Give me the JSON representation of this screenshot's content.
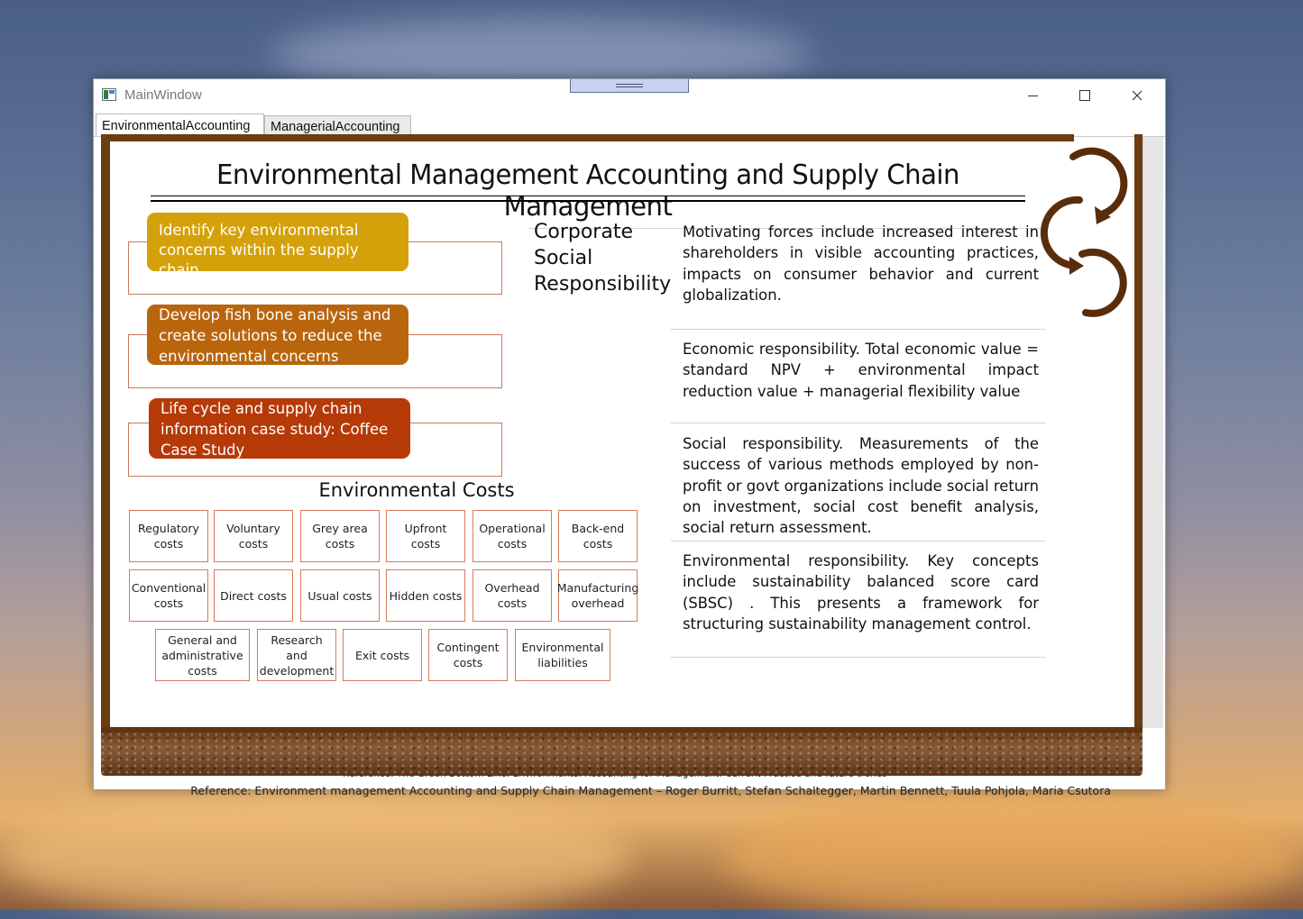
{
  "window": {
    "title": "MainWindow",
    "controls": {
      "minimize": "—",
      "maximize": "☐",
      "close": "✕"
    }
  },
  "tabs": [
    {
      "label": "EnvironmentalAccounting",
      "active": true
    },
    {
      "label": "ManagerialAccounting",
      "active": false
    }
  ],
  "slide": {
    "title": "Environmental Management Accounting and Supply Chain Management",
    "steps": [
      {
        "text": "Identify key environmental concerns within the supply chain",
        "color": "#d4a10a"
      },
      {
        "text": "Develop fish bone analysis and create solutions to reduce the environmental concerns",
        "color": "#b9650e"
      },
      {
        "text": "Life cycle and supply chain information case study: Coffee Case Study",
        "color": "#b63a08"
      }
    ],
    "costs_title": "Environmental Costs",
    "costs_row1": [
      "Regulatory costs",
      "Voluntary costs",
      "Grey area costs",
      "Upfront costs",
      "Operational costs",
      "Back-end costs"
    ],
    "costs_row2": [
      "Conventional costs",
      "Direct costs",
      "Usual costs",
      "Hidden costs",
      "Overhead costs",
      "Manufacturing overhead"
    ],
    "costs_row3": [
      "General and administrative costs",
      "Research and development",
      "Exit costs",
      "Contingent costs",
      "Environmental liabilities"
    ],
    "csr_title": "Corporate Social Responsibility",
    "paragraphs": [
      "Motivating forces include increased interest in shareholders in visible accounting practices, impacts on consumer behavior and current globalization.",
      "Economic responsibility. Total economic value = standard NPV + environmental impact reduction value + managerial flexibility value",
      "Social responsibility. Measurements of the success of various methods employed by non-profit or govt organizations include social return on investment, social cost benefit analysis, social return assessment.",
      "Environmental responsibility. Key concepts include sustainability balanced score card (SBSC) . This presents a framework for structuring sustainability management control."
    ],
    "reference_1": "Reference: The Green Bottom Line: Environmental Accounting for Management: Current Practice and future trends",
    "reference_2": "Reference: Environment management Accounting and Supply Chain Management – Roger Burritt, Stefan Schaltegger, Martin Bennett, Tuula Pohjola, Maria Csutora"
  },
  "colors": {
    "frame": "#6b3d12",
    "cost_border": "#d87a5a",
    "cycle": "#5a2d0a"
  }
}
